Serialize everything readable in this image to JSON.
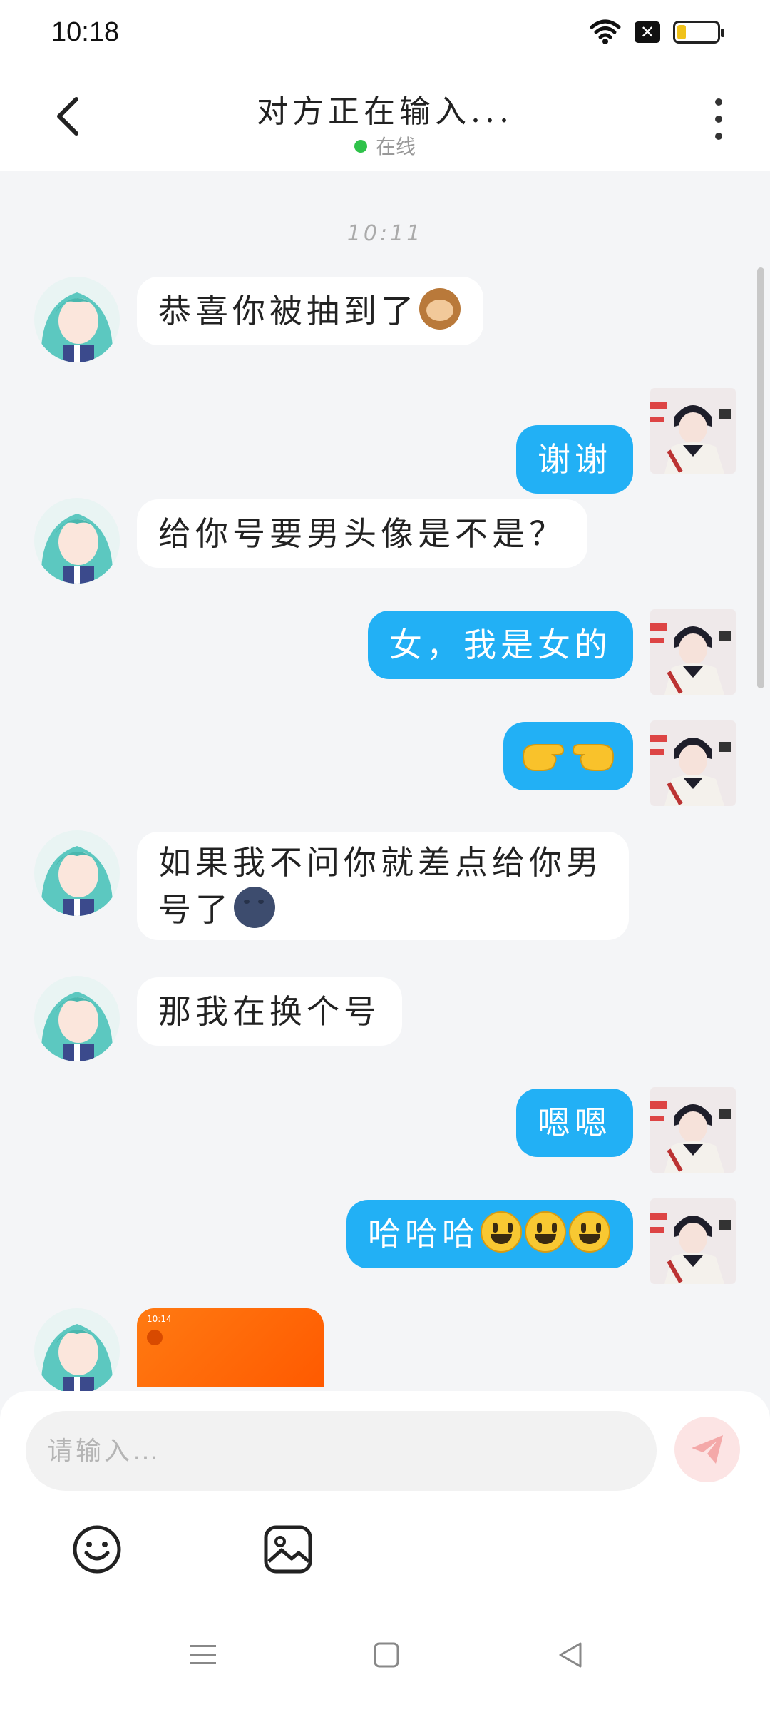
{
  "status_bar": {
    "time": "10:18",
    "icons": [
      "wifi-icon",
      "close-notification-icon",
      "battery-icon"
    ],
    "battery_level": 0.2
  },
  "header": {
    "title": "对方正在输入...",
    "status": "在线",
    "status_color": "#2fc24a"
  },
  "chat": {
    "timestamp": "10:11",
    "messages": [
      {
        "from": "them",
        "text": "恭喜你被抽到了",
        "emoji": "monkey"
      },
      {
        "from": "me",
        "text": "谢谢"
      },
      {
        "from": "them",
        "text": "给你号要男头像是不是？"
      },
      {
        "from": "me",
        "text": "女，我是女的"
      },
      {
        "from": "me",
        "text": "",
        "emoji": "pointing-hands"
      },
      {
        "from": "them",
        "text_line1": "如果我不问你就差点给你男",
        "text_line2": "号了",
        "emoji": "new-moon-face"
      },
      {
        "from": "them",
        "text": "那我在换个号"
      },
      {
        "from": "me",
        "text": "嗯嗯"
      },
      {
        "from": "me",
        "text": "哈哈哈",
        "emoji": "smiley x3"
      },
      {
        "from": "them",
        "type": "image",
        "image_caption": "10:14"
      }
    ]
  },
  "input": {
    "placeholder": "请输入…",
    "value": ""
  },
  "colors": {
    "outgoing_bubble": "#22b0f5",
    "incoming_bubble": "#ffffff",
    "background": "#f4f5f7",
    "send_button": "#fce4e4"
  },
  "toolbar": {
    "buttons": [
      "emoji-picker-icon",
      "image-picker-icon"
    ]
  },
  "nav": {
    "buttons": [
      "menu-icon",
      "home-icon",
      "back-triangle-icon"
    ]
  }
}
